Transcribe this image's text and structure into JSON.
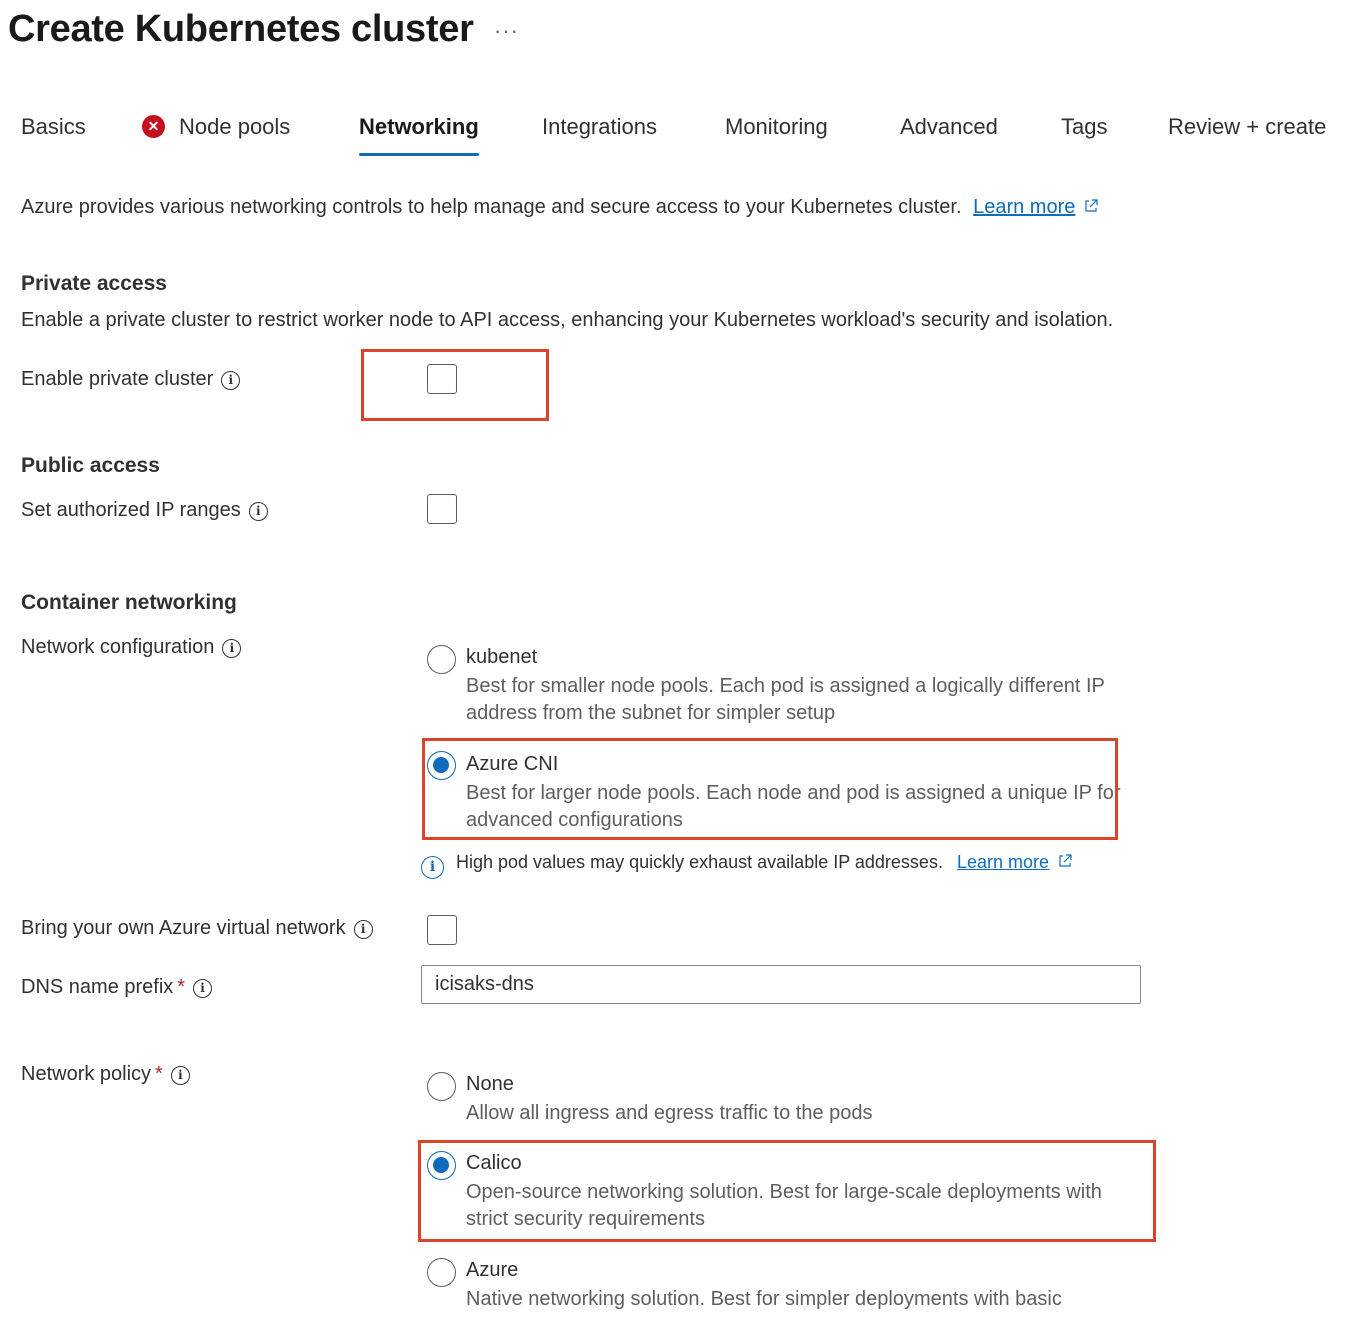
{
  "page": {
    "title": "Create Kubernetes cluster",
    "more_label": "···"
  },
  "tabs": [
    {
      "label": "Basics"
    },
    {
      "label": "Node pools",
      "error_icon": "error-circle-icon"
    },
    {
      "label": "Networking",
      "active": true
    },
    {
      "label": "Integrations"
    },
    {
      "label": "Monitoring"
    },
    {
      "label": "Advanced"
    },
    {
      "label": "Tags"
    },
    {
      "label": "Review + create"
    }
  ],
  "intro": {
    "text": "Azure provides various networking controls to help manage and secure access to your Kubernetes cluster.",
    "link": "Learn more"
  },
  "private_access": {
    "heading": "Private access",
    "description": "Enable a private cluster to restrict worker node to API access, enhancing your Kubernetes workload's security and isolation.",
    "enable_private_cluster": {
      "label": "Enable private cluster",
      "checked": false
    }
  },
  "public_access": {
    "heading": "Public access",
    "authorized_ip": {
      "label": "Set authorized IP ranges",
      "checked": false
    }
  },
  "container_networking": {
    "heading": "Container networking",
    "network_configuration": {
      "label": "Network configuration",
      "options": [
        {
          "title": "kubenet",
          "description": "Best for smaller node pools. Each pod is assigned a logically different IP address from the subnet for simpler setup",
          "selected": false
        },
        {
          "title": "Azure CNI",
          "description": "Best for larger node pools. Each node and pod is assigned a unique IP for advanced configurations",
          "selected": true
        }
      ],
      "info_note": "High pod values may quickly exhaust available IP addresses.",
      "info_link": "Learn more"
    },
    "byo_vnet": {
      "label": "Bring your own Azure virtual network",
      "checked": false
    },
    "dns_prefix": {
      "label": "DNS name prefix",
      "required_mark": "*",
      "value": "icisaks-dns"
    },
    "network_policy": {
      "label": "Network policy",
      "required_mark": "*",
      "options": [
        {
          "title": "None",
          "description": "Allow all ingress and egress traffic to the pods",
          "selected": false
        },
        {
          "title": "Calico",
          "description": "Open-source networking solution. Best for large-scale deployments with strict security requirements",
          "selected": true
        },
        {
          "title": "Azure",
          "description": "Native networking solution. Best for simpler deployments with basic",
          "selected": false
        }
      ]
    }
  },
  "colors": {
    "accent": "#0f6cbd",
    "highlight": "#d9452b",
    "error": "#c50f1f"
  }
}
